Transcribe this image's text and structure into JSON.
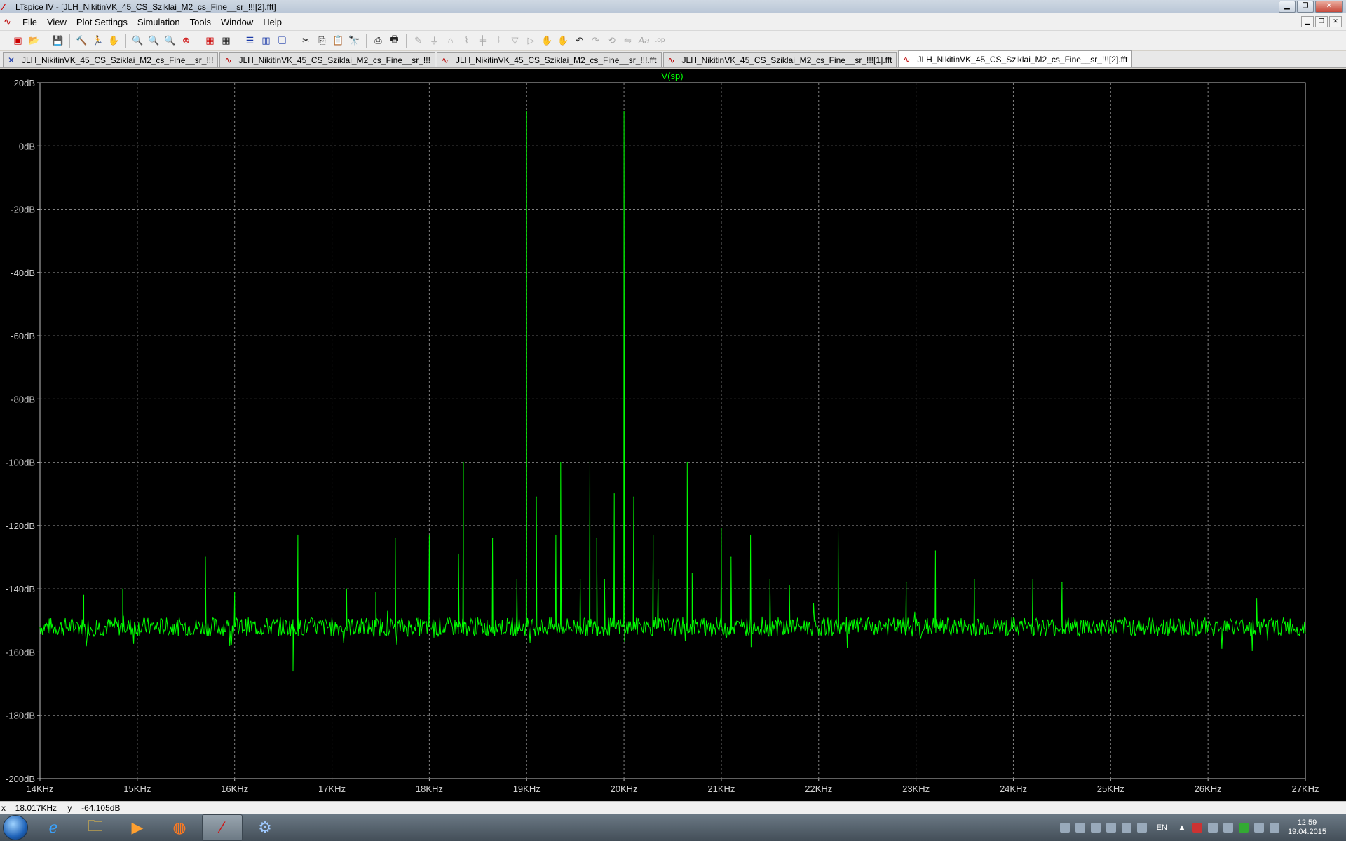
{
  "window": {
    "title": "LTspice IV - [JLH_NikitinVK_45_CS_Sziklai_M2_cs_Fine__sr_!!![2].fft]"
  },
  "menu": [
    "File",
    "View",
    "Plot Settings",
    "Simulation",
    "Tools",
    "Window",
    "Help"
  ],
  "toolbar": {
    "icons": [
      "new-schematic-icon",
      "open-icon",
      "save-icon",
      "control-panel-icon",
      "run-icon",
      "halt-icon",
      "zoom-in-icon",
      "zoom-out-icon",
      "zoom-fit-icon",
      "zoom-cancel-icon",
      "autorange-icon",
      "grid-icon",
      "tile-horizontal-icon",
      "tile-vertical-icon",
      "cascade-icon",
      "cut-icon",
      "copy-icon",
      "paste-icon",
      "find-icon",
      "print-icon",
      "print-preview-icon",
      "wire-icon",
      "ground-icon",
      "label-icon",
      "resistor-icon",
      "capacitor-icon",
      "inductor-icon",
      "diode-icon",
      "component-icon",
      "move-icon",
      "drag-icon",
      "undo-icon",
      "redo-icon",
      "rotate-icon",
      "mirror-icon",
      "text-icon",
      "spice-directive-icon"
    ]
  },
  "tabs": [
    {
      "label": "JLH_NikitinVK_45_CS_Sziklai_M2_cs_Fine__sr_!!!",
      "icon": "schematic-icon",
      "active": false
    },
    {
      "label": "JLH_NikitinVK_45_CS_Sziklai_M2_cs_Fine__sr_!!!",
      "icon": "waveform-icon",
      "active": false
    },
    {
      "label": "JLH_NikitinVK_45_CS_Sziklai_M2_cs_Fine__sr_!!!.fft",
      "icon": "waveform-icon",
      "active": false
    },
    {
      "label": "JLH_NikitinVK_45_CS_Sziklai_M2_cs_Fine__sr_!!![1].fft",
      "icon": "waveform-icon",
      "active": false
    },
    {
      "label": "JLH_NikitinVK_45_CS_Sziklai_M2_cs_Fine__sr_!!![2].fft",
      "icon": "waveform-icon",
      "active": true
    }
  ],
  "colors": {
    "trace": "#00ff00",
    "background": "#000000",
    "grid": "#808080",
    "axis_text": "#d0d0d0"
  },
  "status": {
    "x_readout": "x = 18.017KHz",
    "y_readout": "y = -64.105dB"
  },
  "taskbar": {
    "apps": [
      "internet-explorer-icon",
      "explorer-icon",
      "media-player-icon",
      "firefox-icon",
      "ltspice-icon",
      "control-panel-icon"
    ],
    "language": "EN",
    "time": "12:59",
    "date": "19.04.2015"
  },
  "chart_data": {
    "type": "line",
    "title": "V(sp)",
    "xlabel": "",
    "ylabel": "",
    "xlim": [
      14,
      27
    ],
    "ylim": [
      -200,
      20
    ],
    "x_unit": "KHz",
    "y_unit": "dB",
    "x_ticks": [
      14,
      15,
      16,
      17,
      18,
      19,
      20,
      21,
      22,
      23,
      24,
      25,
      26,
      27
    ],
    "x_tick_labels": [
      "14KHz",
      "15KHz",
      "16KHz",
      "17KHz",
      "18KHz",
      "19KHz",
      "20KHz",
      "21KHz",
      "22KHz",
      "23KHz",
      "24KHz",
      "25KHz",
      "26KHz",
      "27KHz"
    ],
    "y_ticks": [
      20,
      0,
      -20,
      -40,
      -60,
      -80,
      -100,
      -120,
      -140,
      -160,
      -180,
      -200
    ],
    "y_tick_labels": [
      "20dB",
      "0dB",
      "-20dB",
      "-40dB",
      "-60dB",
      "-80dB",
      "-100dB",
      "-120dB",
      "-140dB",
      "-160dB",
      "-180dB",
      "-200dB"
    ],
    "grid": true,
    "noise_floor_db": -152,
    "series": [
      {
        "name": "V(sp)",
        "peaks": [
          {
            "x": 19.0,
            "y": 11
          },
          {
            "x": 20.0,
            "y": 11
          },
          {
            "x": 18.35,
            "y": -100
          },
          {
            "x": 19.35,
            "y": -100
          },
          {
            "x": 19.65,
            "y": -100
          },
          {
            "x": 20.65,
            "y": -100
          },
          {
            "x": 18.3,
            "y": -129
          },
          {
            "x": 18.65,
            "y": -124
          },
          {
            "x": 17.65,
            "y": -124
          },
          {
            "x": 18.0,
            "y": -123
          },
          {
            "x": 19.3,
            "y": -123
          },
          {
            "x": 19.72,
            "y": -124
          },
          {
            "x": 20.3,
            "y": -123
          },
          {
            "x": 21.0,
            "y": -121
          },
          {
            "x": 21.3,
            "y": -123
          },
          {
            "x": 22.2,
            "y": -121
          },
          {
            "x": 16.65,
            "y": -123
          },
          {
            "x": 15.7,
            "y": -130
          },
          {
            "x": 18.9,
            "y": -137
          },
          {
            "x": 19.1,
            "y": -111
          },
          {
            "x": 19.9,
            "y": -110
          },
          {
            "x": 20.1,
            "y": -111
          },
          {
            "x": 20.35,
            "y": -137
          },
          {
            "x": 20.7,
            "y": -135
          },
          {
            "x": 21.1,
            "y": -130
          },
          {
            "x": 23.2,
            "y": -128
          },
          {
            "x": 22.9,
            "y": -138
          },
          {
            "x": 23.6,
            "y": -137
          },
          {
            "x": 24.2,
            "y": -137
          },
          {
            "x": 24.5,
            "y": -138
          },
          {
            "x": 14.45,
            "y": -142
          },
          {
            "x": 14.85,
            "y": -140
          },
          {
            "x": 16.0,
            "y": -141
          },
          {
            "x": 17.15,
            "y": -140
          },
          {
            "x": 17.45,
            "y": -141
          },
          {
            "x": 19.55,
            "y": -137
          },
          {
            "x": 19.8,
            "y": -137
          },
          {
            "x": 21.5,
            "y": -137
          },
          {
            "x": 21.7,
            "y": -139
          },
          {
            "x": 26.5,
            "y": -143
          },
          {
            "x": 16.6,
            "y": -166
          }
        ]
      }
    ]
  }
}
